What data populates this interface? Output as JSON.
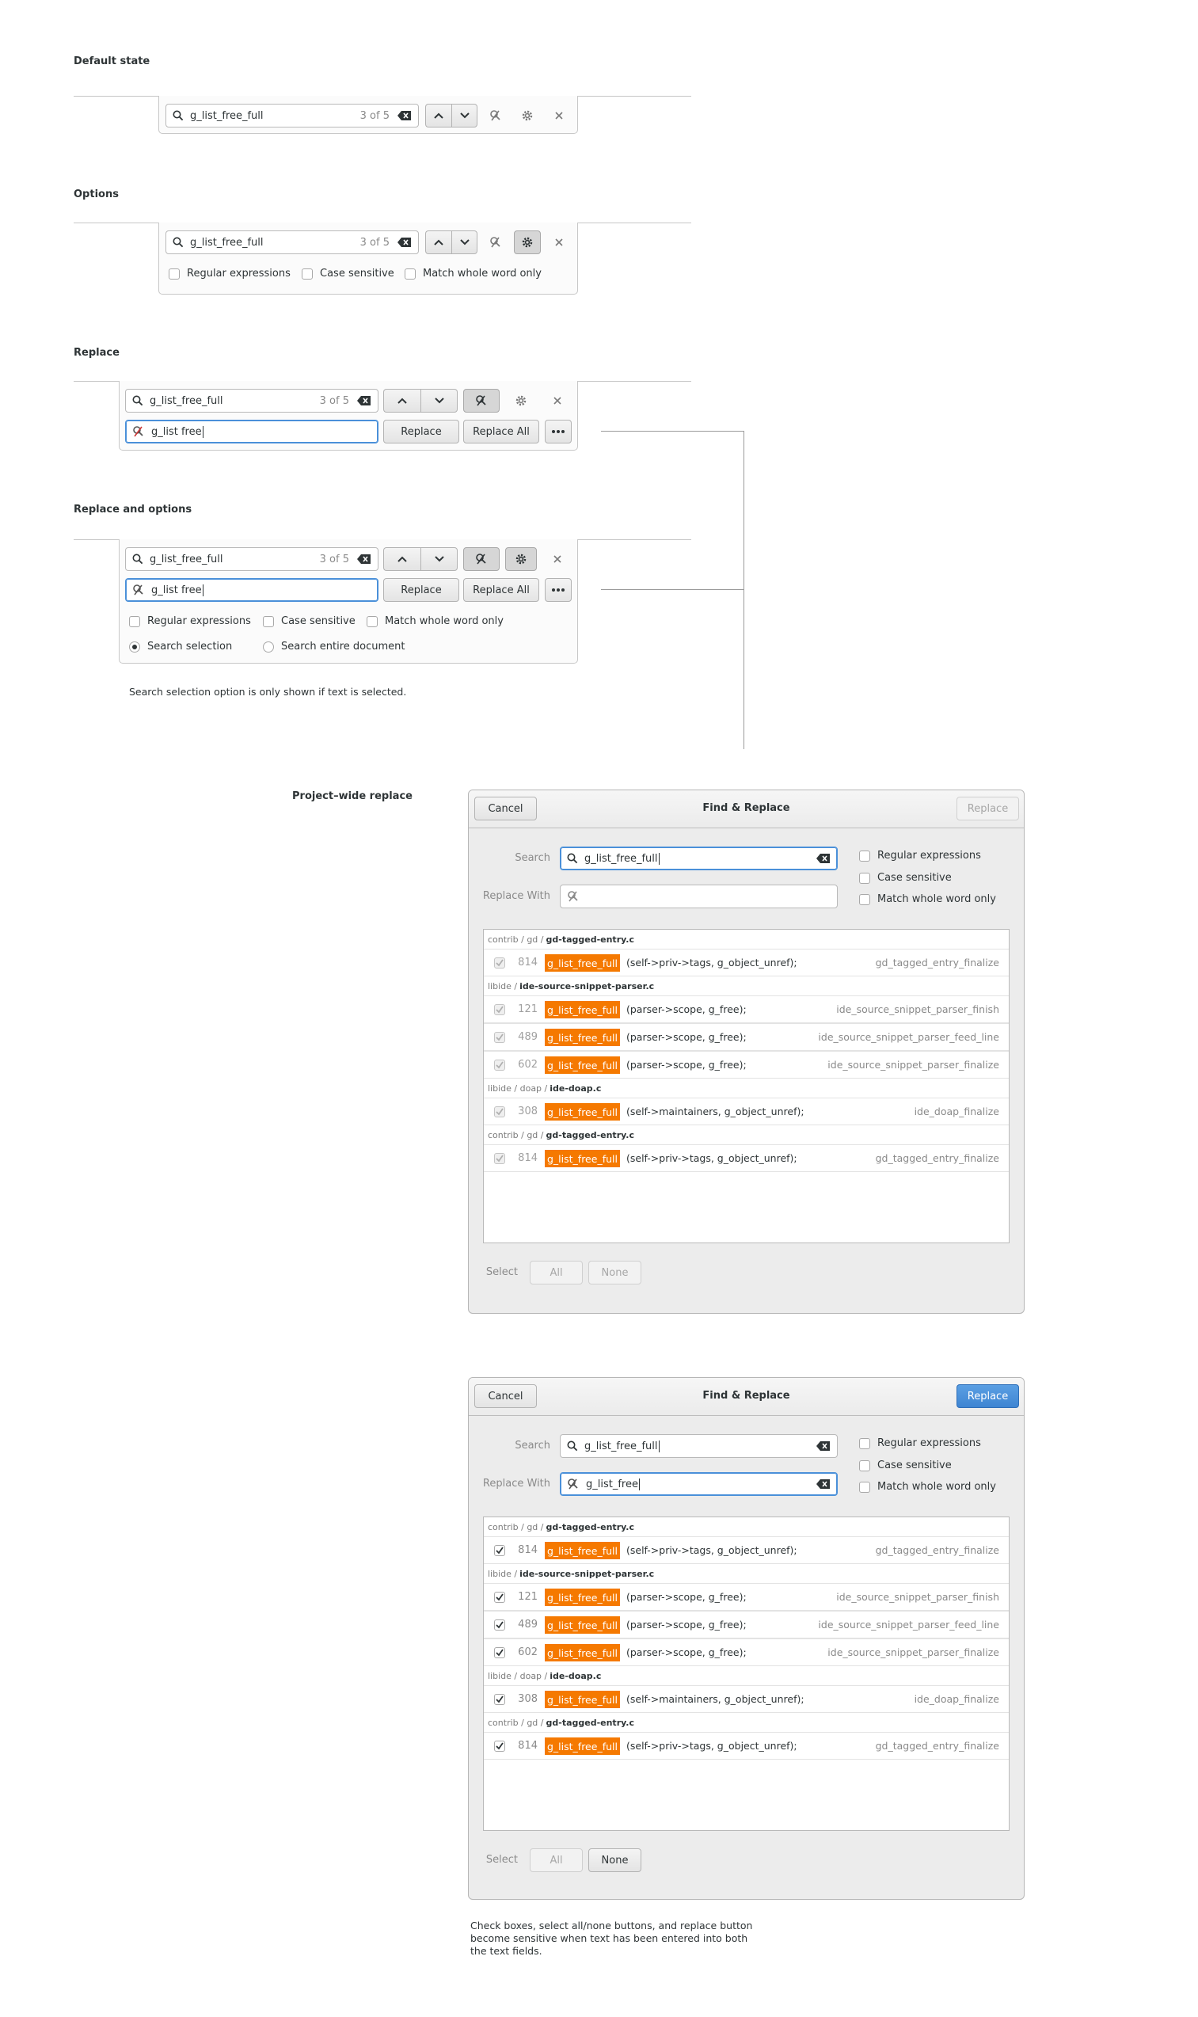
{
  "sections": {
    "default_state": "Default state",
    "options": "Options",
    "replace": "Replace",
    "replace_and_options": "Replace and options",
    "project_wide": "Project–wide replace"
  },
  "search": {
    "query": "g_list_free_full",
    "count": "3 of 5"
  },
  "replace_entry": {
    "value": "g_list free"
  },
  "buttons": {
    "replace": "Replace",
    "replace_all": "Replace All"
  },
  "options": {
    "regex": "Regular expressions",
    "case": "Case sensitive",
    "whole_word": "Match whole word only",
    "search_selection": "Search selection",
    "search_document": "Search entire document"
  },
  "notes": {
    "selection_note": "Search selection option is only shown if text is selected.",
    "final_note_1": "Check boxes, select all/none buttons, and replace button",
    "final_note_2": "become sensitive when text has been entered into both",
    "final_note_3": "the text fields."
  },
  "dialog": {
    "cancel": "Cancel",
    "title": "Find & Replace",
    "replace": "Replace",
    "search_label": "Search",
    "replace_with_label": "Replace With",
    "search_value": "g_list_free_full",
    "replace_value": "g_list_free",
    "select_label": "Select",
    "all": "All",
    "none": "None",
    "match": "g_list_free_full",
    "groups": [
      {
        "path": "contrib / gd /",
        "file": "gd-tagged-entry.c"
      },
      {
        "path": "libide /",
        "file": "ide-source-snippet-parser.c"
      },
      {
        "path": "libide / doap /",
        "file": "ide-doap.c"
      },
      {
        "path": "contrib / gd /",
        "file": "gd-tagged-entry.c"
      }
    ],
    "rows": [
      {
        "line": "814",
        "rest": "(self->priv->tags, g_object_unref);",
        "fn": "gd_tagged_entry_finalize"
      },
      {
        "line": "121",
        "rest": "(parser->scope, g_free);",
        "fn": "ide_source_snippet_parser_finish"
      },
      {
        "line": "489",
        "rest": "(parser->scope, g_free);",
        "fn": "ide_source_snippet_parser_feed_line"
      },
      {
        "line": "602",
        "rest": "(parser->scope, g_free);",
        "fn": "ide_source_snippet_parser_finalize"
      },
      {
        "line": "308",
        "rest": "(self->maintainers, g_object_unref);",
        "fn": "ide_doap_finalize"
      },
      {
        "line": "814",
        "rest": "(self->priv->tags, g_object_unref);",
        "fn": "gd_tagged_entry_finalize"
      }
    ]
  },
  "colors": {
    "highlight": "#f57900",
    "accent": "#4a90d9",
    "suggested": "#3f85d2"
  }
}
